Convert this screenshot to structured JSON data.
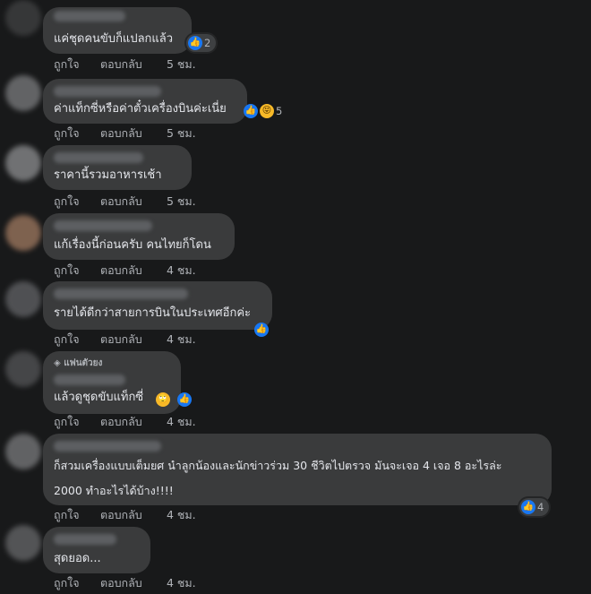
{
  "comments": [
    {
      "text": "แค่ชุดคนขับก็แปลกแล้ว",
      "reaction_count": "2",
      "like": "ถูกใจ",
      "reply": "ตอบกลับ",
      "time": "5 ชม."
    },
    {
      "text": "ค่าแท็กซี่หรือค่าตั๋วเครื่องบินค่ะเนี่ย",
      "reaction_count": "5",
      "like": "ถูกใจ",
      "reply": "ตอบกลับ",
      "time": "5 ชม."
    },
    {
      "text": "ราคานี้รวมอาหารเช้า",
      "like": "ถูกใจ",
      "reply": "ตอบกลับ",
      "time": "5 ชม."
    },
    {
      "text": "แก้เรื่องนี้ก่อนครับ คนไทยก็โดน",
      "like": "ถูกใจ",
      "reply": "ตอบกลับ",
      "time": "4 ชม."
    },
    {
      "text": "รายได้ดีกว่าสายการบินในประเทศอีกค่ะ",
      "like": "ถูกใจ",
      "reply": "ตอบกลับ",
      "time": "4 ชม."
    },
    {
      "badge": "แฟนตัวยง",
      "text": "แล้วดูชุดขับแท็กซี่",
      "like": "ถูกใจ",
      "reply": "ตอบกลับ",
      "time": "4 ชม."
    },
    {
      "text_line1": "ก็สวมเครื่องแบบเต็มยศ นำลูกน้องและนักข่าวร่วม 30 ชีวิตไปตรวจ มันจะเจอ 4 เจอ 8 อะไรล่ะ",
      "text_line2": "2000 ทำอะไรได้บ้าง!!!!",
      "reaction_count": "4",
      "like": "ถูกใจ",
      "reply": "ตอบกลับ",
      "time": "4 ชม."
    },
    {
      "text": "สุดยอด...",
      "like": "ถูกใจ",
      "reply": "ตอบกลับ",
      "time": "4 ชม."
    }
  ],
  "icons": {
    "like": "thumbs-up-icon",
    "haha": "laughing-emoji-icon",
    "eyeroll": "eye-roll-emoji-icon",
    "fan": "diamond-icon"
  },
  "colors": {
    "background": "#18191a",
    "bubble": "#3a3b3c",
    "like_blue": "#1877f2",
    "muted": "#b0b3b8"
  }
}
